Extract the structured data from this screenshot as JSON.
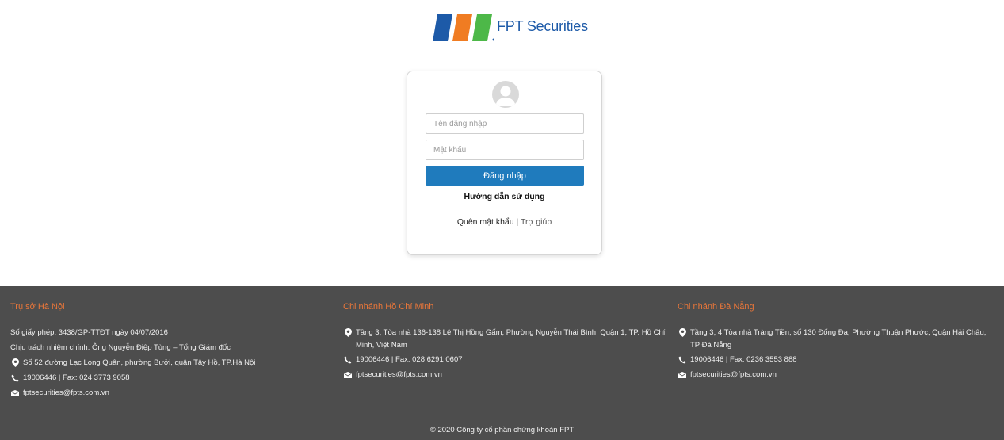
{
  "brand": {
    "name": "FPT Securities",
    "colors": {
      "blue": "#1d5aa8",
      "orange": "#f07c22",
      "green": "#4db848"
    }
  },
  "login": {
    "username_placeholder": "Tên đăng nhập",
    "password_placeholder": "Mật khẩu",
    "submit_label": "Đăng nhập",
    "guide_label": "Hướng dẫn sử dụng",
    "forgot_label": "Quên mật khẩu",
    "separator": "|",
    "help_label": "Trợ giúp"
  },
  "footer": {
    "hanoi": {
      "title": "Trụ sở Hà Nội",
      "license": "Số giấy phép: 3438/GP-TTĐT ngày 04/07/2016",
      "responsible": "Chịu trách nhiệm chính: Ông Nguyễn Điệp Tùng – Tổng Giám đốc",
      "address": "Số 52 đường Lạc Long Quân, phường Bưởi, quận Tây Hồ, TP.Hà Nội",
      "phone": "19006446 | Fax: 024 3773 9058",
      "email": "fptsecurities@fpts.com.vn"
    },
    "hcm": {
      "title": "Chi nhánh Hồ Chí Minh",
      "address": "Tầng 3, Tòa nhà 136-138 Lê Thị Hồng Gấm, Phường Nguyễn Thái Bình, Quận 1, TP. Hồ Chí Minh, Việt Nam",
      "phone": "19006446 | Fax: 028 6291 0607",
      "email": "fptsecurities@fpts.com.vn"
    },
    "danang": {
      "title": "Chi nhánh Đà Nẵng",
      "address": "Tầng 3, 4 Tòa nhà Tràng Tiền, số 130 Đống Đa, Phường Thuận Phước, Quận Hải Châu, TP Đà Nẵng",
      "phone": "19006446 | Fax: 0236 3553 888",
      "email": "fptsecurities@fpts.com.vn"
    },
    "copyright": "© 2020 Công ty cổ phần chứng khoán FPT"
  }
}
